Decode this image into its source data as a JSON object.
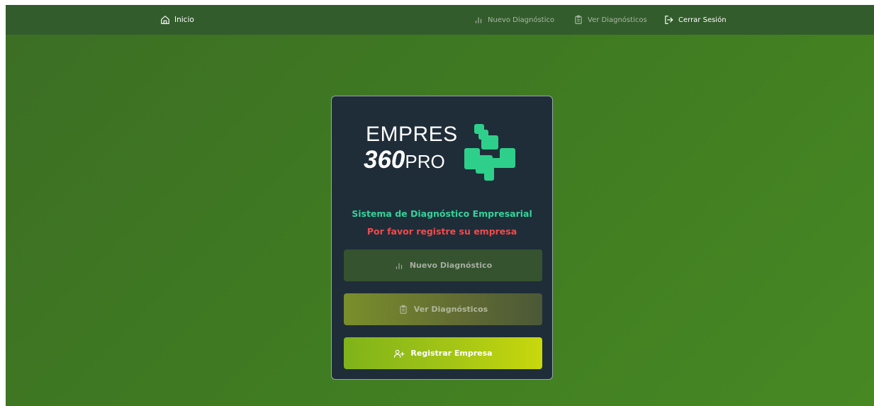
{
  "navbar": {
    "home_label": "Inicio",
    "new_label": "Nuevo Diagnóstico",
    "view_label": "Ver Diagnósticos",
    "logout_label": "Cerrar Sesión"
  },
  "logo": {
    "line1": "EMPRES",
    "number": "360",
    "suffix": "PRO",
    "mark_color": "#2ecf8a"
  },
  "card": {
    "subtitle": "Sistema de Diagnóstico Empresarial",
    "notice": "Por favor registre su empresa",
    "buttons": {
      "new_diagnostic": "Nuevo Diagnóstico",
      "view_diagnostics": "Ver Diagnósticos",
      "register_company": "Registrar Empresa"
    }
  },
  "colors": {
    "navbar": "#335c2c",
    "background": "#3f7a22",
    "card": "#1f2d39",
    "subtitle": "#34d399",
    "notice": "#f04a4a",
    "register_button": "#a4c516"
  },
  "icons": {
    "home": "home-icon",
    "new": "bar-chart-icon",
    "view": "clipboard-icon",
    "logout": "logout-icon",
    "register": "user-plus-icon"
  }
}
